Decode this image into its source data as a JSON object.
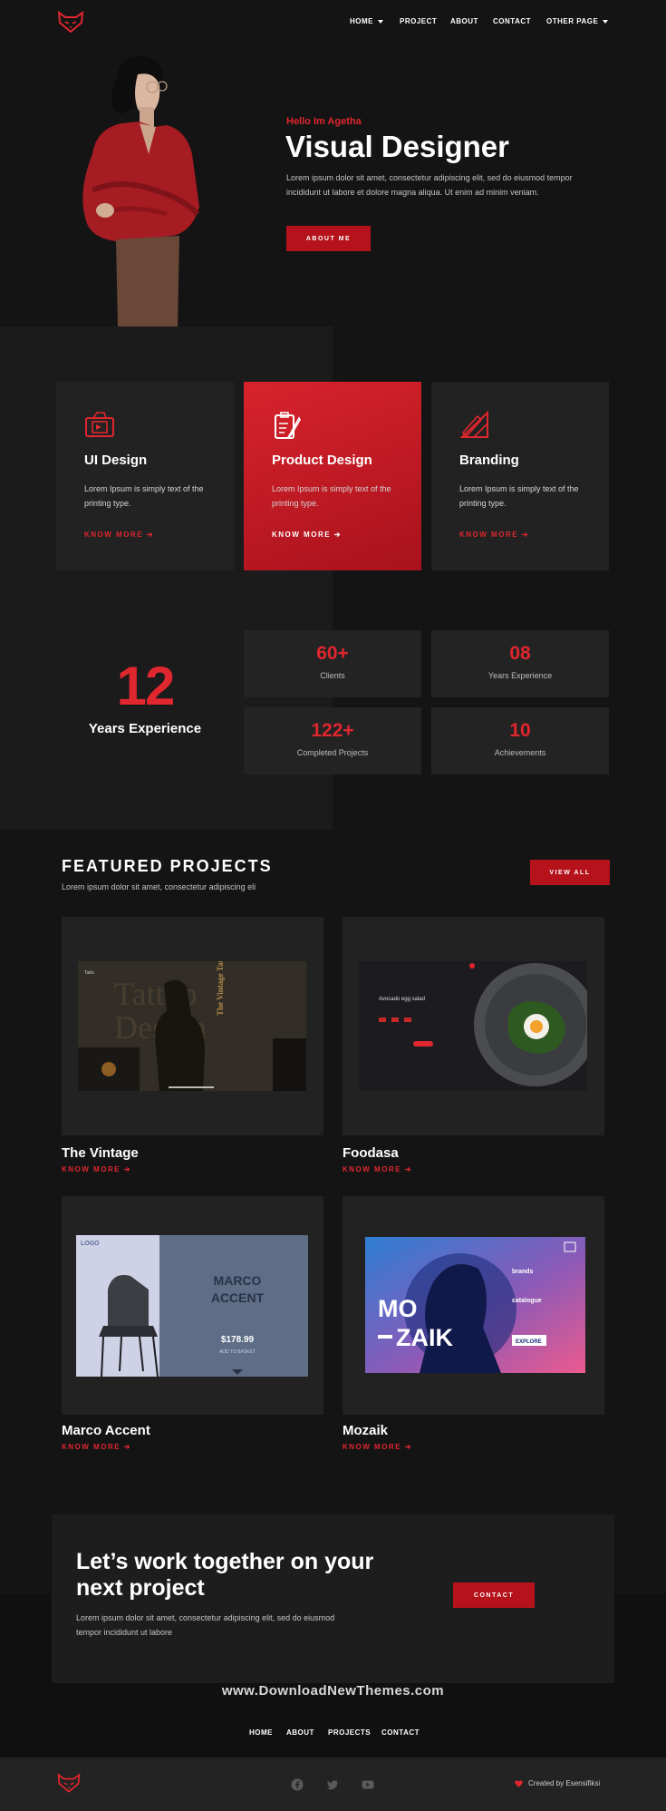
{
  "header": {
    "nav": [
      "HOME",
      "PROJECT",
      "ABOUT",
      "CONTACT",
      "OTHER PAGE"
    ]
  },
  "hero": {
    "greeting": "Hello Im Agetha",
    "title": "Visual Designer",
    "description": "Lorem ipsum dolor sit amet, consectetur adipiscing elit, sed do eiusmod tempor incididunt ut labore et dolore magna aliqua. Ut enim ad minim veniam.",
    "button": "ABOUT ME"
  },
  "services": [
    {
      "title": "UI Design",
      "description": "Lorem Ipsum is simply text of the printing type.",
      "link": "KNOW MORE"
    },
    {
      "title": "Product Design",
      "description": "Lorem Ipsum is simply text of the printing type.",
      "link": "KNOW MORE"
    },
    {
      "title": "Branding",
      "description": "Lorem Ipsum is simply text of the printing type.",
      "link": "KNOW MORE"
    }
  ],
  "experience": {
    "years": "12",
    "label": "Years Experience",
    "stats": [
      {
        "value": "60+",
        "label": "Clients"
      },
      {
        "value": "08",
        "label": "Years Experience"
      },
      {
        "value": "122+",
        "label": "Completed Projects"
      },
      {
        "value": "10",
        "label": "Achievements"
      }
    ]
  },
  "projects": {
    "title": "FEATURED PROJECTS",
    "subtitle": "Lorem ipsum dolor sit amet, consectetur adipiscing eli",
    "button": "VIEW ALL",
    "items": [
      {
        "name": "The Vintage",
        "link": "KNOW MORE"
      },
      {
        "name": "Foodasa",
        "link": "KNOW MORE"
      },
      {
        "name": "Marco Accent",
        "link": "KNOW MORE"
      },
      {
        "name": "Mozaik",
        "link": "KNOW MORE"
      }
    ],
    "thumbs": {
      "vintage": {
        "brand": "Tatto",
        "headline": "The Vintage Tattoo Design"
      },
      "foodasa": {
        "headline": "Avocado egg salad"
      },
      "marco": {
        "logo": "LOGO",
        "title_1": "MARCO",
        "title_2": "ACCENT",
        "price": "$178.99",
        "cta": "ADD TO BASKET"
      },
      "mozaik": {
        "title_1": "MO",
        "title_2": "ZAIK",
        "label_1": "brands",
        "label_2": "catalogue",
        "button": "EXPLORE"
      }
    }
  },
  "cta": {
    "title": "Let’s work together on your next project",
    "description": "Lorem ipsum dolor sit amet, consectetur adipiscing elit, sed do eiusmod tempor incididunt ut labore",
    "button": "CONTACT"
  },
  "watermark": "www.DownloadNewThemes.com",
  "footer": {
    "nav": [
      "HOME",
      "ABOUT",
      "PROJECTS",
      "CONTACT"
    ],
    "credit": "Created by Esensifiksi"
  },
  "colors": {
    "accent": "#e0262e",
    "button": "#b5121b",
    "background": "#141414",
    "card": "#222222"
  },
  "icons": [
    "fox-logo-icon",
    "ui-design-icon",
    "product-design-icon",
    "branding-icon",
    "arrow-right-icon",
    "facebook-icon",
    "twitter-icon",
    "youtube-icon",
    "heart-icon"
  ]
}
